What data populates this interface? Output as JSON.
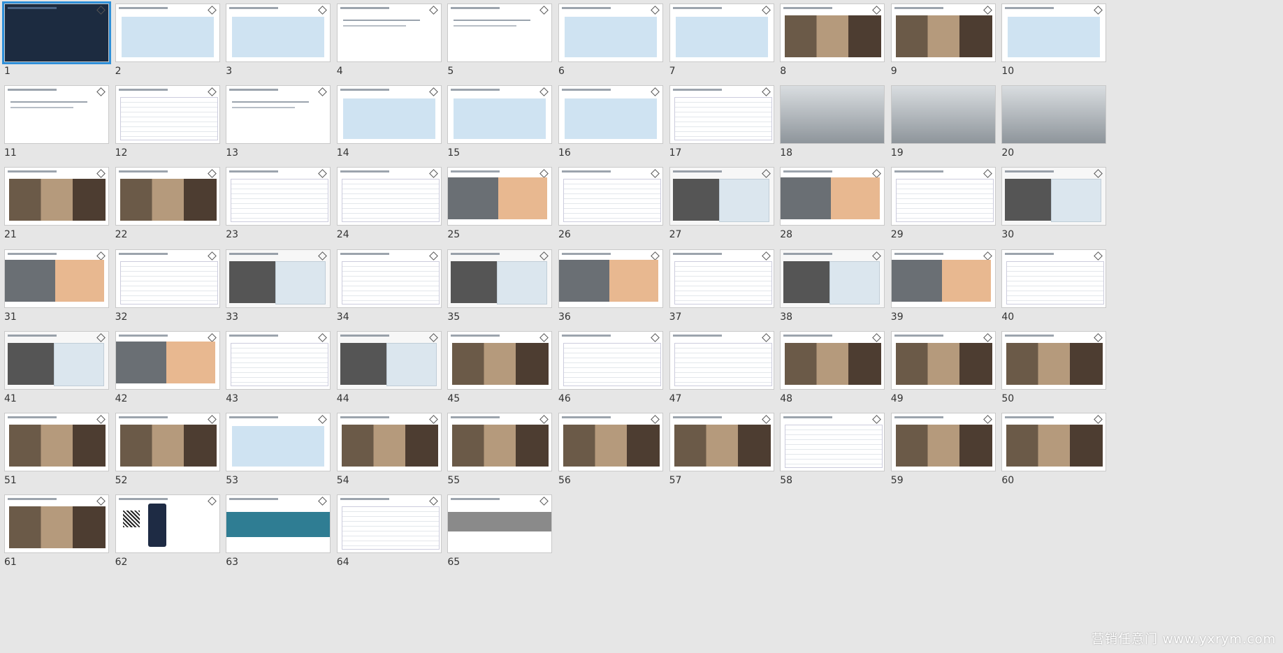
{
  "watermark": "营销任意门 www.yxrym.com",
  "slides": [
    {
      "n": "1",
      "style": "dark",
      "selected": true
    },
    {
      "n": "2",
      "style": "banner"
    },
    {
      "n": "3",
      "style": "banner"
    },
    {
      "n": "4",
      "style": "plain"
    },
    {
      "n": "5",
      "style": "plain"
    },
    {
      "n": "6",
      "style": "banner"
    },
    {
      "n": "7",
      "style": "banner"
    },
    {
      "n": "8",
      "style": "collage"
    },
    {
      "n": "9",
      "style": "collage"
    },
    {
      "n": "10",
      "style": "banner"
    },
    {
      "n": "11",
      "style": "plain"
    },
    {
      "n": "12",
      "style": "table"
    },
    {
      "n": "13",
      "style": "plain"
    },
    {
      "n": "14",
      "style": "banner"
    },
    {
      "n": "15",
      "style": "banner"
    },
    {
      "n": "16",
      "style": "banner"
    },
    {
      "n": "17",
      "style": "table"
    },
    {
      "n": "18",
      "style": "scene"
    },
    {
      "n": "19",
      "style": "scene"
    },
    {
      "n": "20",
      "style": "scene"
    },
    {
      "n": "21",
      "style": "collage"
    },
    {
      "n": "22",
      "style": "collage"
    },
    {
      "n": "23",
      "style": "table"
    },
    {
      "n": "24",
      "style": "table"
    },
    {
      "n": "25",
      "style": "orange"
    },
    {
      "n": "26",
      "style": "table"
    },
    {
      "n": "27",
      "style": "map"
    },
    {
      "n": "28",
      "style": "orange"
    },
    {
      "n": "29",
      "style": "table"
    },
    {
      "n": "30",
      "style": "map"
    },
    {
      "n": "31",
      "style": "orange"
    },
    {
      "n": "32",
      "style": "table"
    },
    {
      "n": "33",
      "style": "map"
    },
    {
      "n": "34",
      "style": "table"
    },
    {
      "n": "35",
      "style": "map"
    },
    {
      "n": "36",
      "style": "orange"
    },
    {
      "n": "37",
      "style": "table"
    },
    {
      "n": "38",
      "style": "map"
    },
    {
      "n": "39",
      "style": "orange"
    },
    {
      "n": "40",
      "style": "table"
    },
    {
      "n": "41",
      "style": "map"
    },
    {
      "n": "42",
      "style": "orange"
    },
    {
      "n": "43",
      "style": "table"
    },
    {
      "n": "44",
      "style": "map"
    },
    {
      "n": "45",
      "style": "collage"
    },
    {
      "n": "46",
      "style": "table"
    },
    {
      "n": "47",
      "style": "table"
    },
    {
      "n": "48",
      "style": "collage"
    },
    {
      "n": "49",
      "style": "collage"
    },
    {
      "n": "50",
      "style": "collage"
    },
    {
      "n": "51",
      "style": "collage"
    },
    {
      "n": "52",
      "style": "collage"
    },
    {
      "n": "53",
      "style": "banner"
    },
    {
      "n": "54",
      "style": "collage"
    },
    {
      "n": "55",
      "style": "collage"
    },
    {
      "n": "56",
      "style": "collage"
    },
    {
      "n": "57",
      "style": "collage"
    },
    {
      "n": "58",
      "style": "table"
    },
    {
      "n": "59",
      "style": "collage"
    },
    {
      "n": "60",
      "style": "collage"
    },
    {
      "n": "61",
      "style": "collage"
    },
    {
      "n": "62",
      "style": "qr"
    },
    {
      "n": "63",
      "style": "teal"
    },
    {
      "n": "64",
      "style": "table"
    },
    {
      "n": "65",
      "style": "thanks"
    }
  ]
}
